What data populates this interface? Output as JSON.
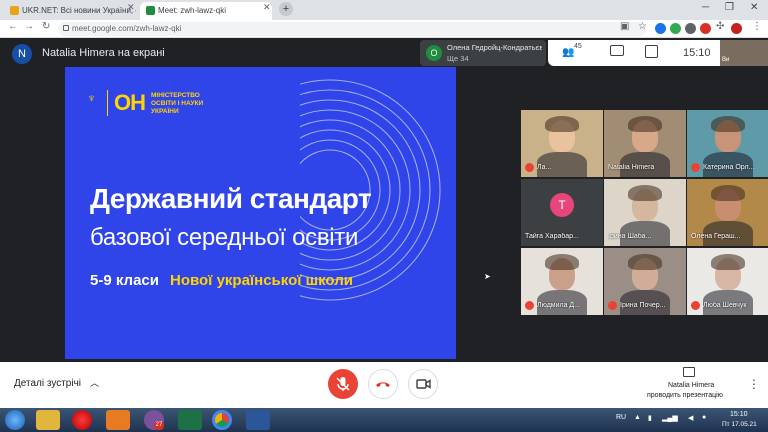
{
  "browser": {
    "tabs": [
      {
        "label": "UKR.NET: Всі новини України, с",
        "favicon_color": "#e8a317",
        "active": false
      },
      {
        "label": "Meet: zwh-lawz-qki",
        "favicon_color": "#1e8e3e",
        "active": true
      }
    ],
    "url": "meet.google.com/zwh-lawz-qki"
  },
  "meet": {
    "presenter_initial": "N",
    "presenter_banner": "Natalia Himera на екрані",
    "notification": {
      "initial": "О",
      "line1": "Олена Гедройц-Кондратьєва",
      "line2": "Ще 34"
    },
    "people_count": "45",
    "time": "15:10",
    "slide": {
      "logo_mark": "ОН",
      "org_name": "МІНІСТЕРСТВО ОСВІТИ І НАУКИ УКРАЇНИ",
      "title_line1": "Державний стандарт",
      "title_line2": "базової середньої освіти",
      "subtitle_grades": "5-9 класи",
      "subtitle_school": "Нової української школи"
    },
    "participants": [
      {
        "name": "Ла...",
        "bg": "#c9b28a",
        "face": "#e8c39e",
        "muted": true
      },
      {
        "name": "Natalia Himera",
        "bg": "#a08d74",
        "face": "#d7a98a",
        "muted": false
      },
      {
        "name": "Катерина Орл...",
        "bg": "#5e9aa8",
        "face": "#c79477",
        "muted": true
      },
      {
        "name": "Тайга Харабар...",
        "bg": "#3c4043",
        "face": "",
        "initial": "Т",
        "muted": false
      },
      {
        "name": "Ірина Шаба...",
        "bg": "#ddd6c8",
        "face": "#d4b79c",
        "muted": false
      },
      {
        "name": "Олена Гераш...",
        "bg": "#b3894a",
        "face": "#c98e6f",
        "muted": false
      },
      {
        "name": "Людмила Д...",
        "bg": "#e6e1da",
        "face": "#c9a18a",
        "muted": true
      },
      {
        "name": "Ірина Почер...",
        "bg": "#9b8e86",
        "face": "#d1ad98",
        "muted": true
      },
      {
        "name": "Люба Шевчук",
        "bg": "#ebe9e5",
        "face": "#d6b7a5",
        "muted": true
      }
    ],
    "self_label": "Ви"
  },
  "bottom": {
    "details_label": "Деталі зустрічі",
    "presenter_name": "Natalia Himera",
    "presenter_status": "проводить презентацію"
  },
  "taskbar": {
    "language": "RU",
    "time": "15:10",
    "date": "Пт 17.05.21",
    "viber_badge": "27"
  }
}
